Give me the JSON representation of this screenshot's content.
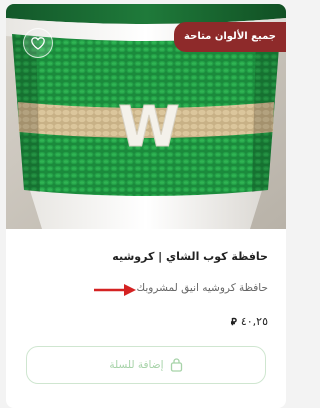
{
  "product": {
    "badge": "جميع الألوان متاحة",
    "title": "حافظة كوب الشاي | كروشيه",
    "description": "حافظة كروشيه انيق لمشروبك",
    "price": "٤٠,٢٥",
    "currency_icon": "riyal-symbol-icon",
    "add_to_cart_label": "إضافة للسلة",
    "image_letter": "W"
  },
  "colors": {
    "badge_bg": "#8e2a2a",
    "cart_border": "#cfe6d0",
    "cart_text": "#a7d3a9",
    "arrow": "#d42222",
    "sleeve_green": "#1e8a3a"
  }
}
